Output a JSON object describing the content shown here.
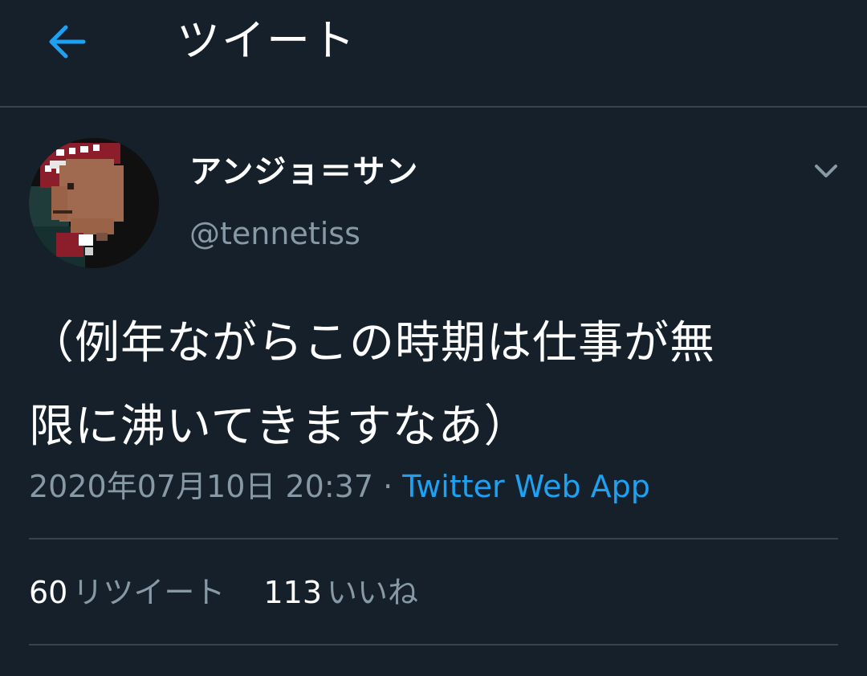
{
  "header": {
    "back_icon": "arrow-left-icon",
    "title": "ツイート"
  },
  "tweet": {
    "author": {
      "name": "アンジョ＝サン",
      "handle": "@tennetiss",
      "avatar": "pixel-art-avatar"
    },
    "menu_icon": "chevron-down-icon",
    "text_lines": [
      "（例年ながらこの時期は仕事が無",
      "限に沸いてきますなあ）"
    ],
    "datetime": "2020年07月10日 20:37",
    "separator": "·",
    "source": "Twitter Web App",
    "stats": {
      "retweets_count": "60",
      "retweets_label": "リツイート",
      "likes_count": "113",
      "likes_label": "いいね"
    }
  },
  "colors": {
    "background": "#15202b",
    "divider": "#38444d",
    "accent": "#1da1f2",
    "secondary_text": "#8899a6",
    "primary_text": "#ffffff"
  }
}
